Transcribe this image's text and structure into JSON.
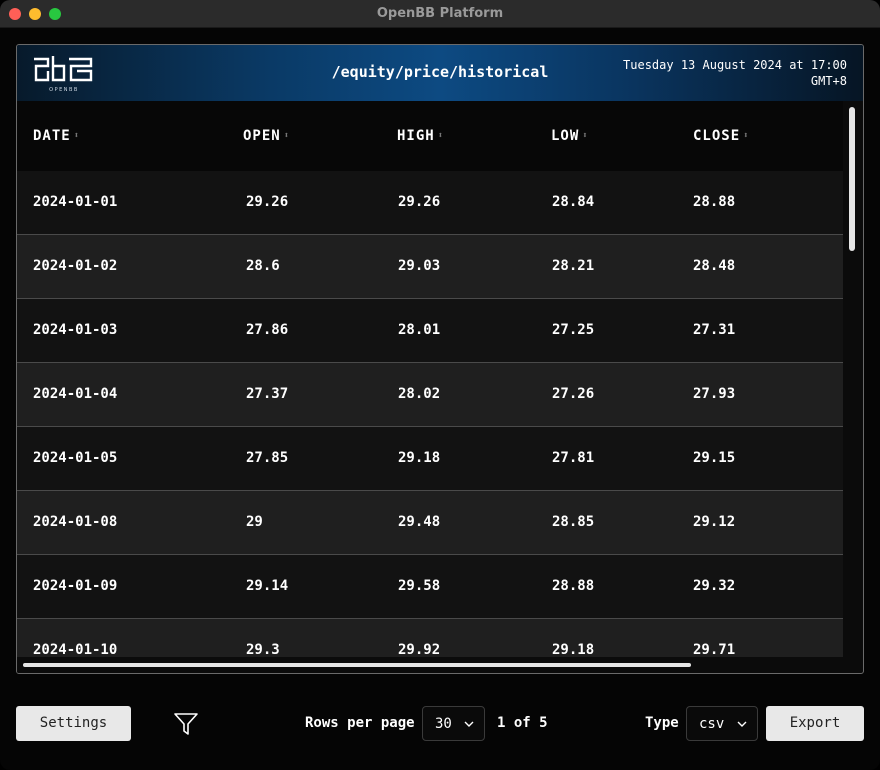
{
  "window": {
    "title": "OpenBB Platform"
  },
  "banner": {
    "logo_text": "OPENBB",
    "command": "/equity/price/historical",
    "date": "Tuesday 13 August 2024 at 17:00",
    "timezone": "GMT+8"
  },
  "table": {
    "columns": [
      "DATE",
      "OPEN",
      "HIGH",
      "LOW",
      "CLOSE"
    ],
    "rows": [
      [
        "2024-01-01",
        "29.26",
        "29.26",
        "28.84",
        "28.88"
      ],
      [
        "2024-01-02",
        "28.6",
        "29.03",
        "28.21",
        "28.48"
      ],
      [
        "2024-01-03",
        "27.86",
        "28.01",
        "27.25",
        "27.31"
      ],
      [
        "2024-01-04",
        "27.37",
        "28.02",
        "27.26",
        "27.93"
      ],
      [
        "2024-01-05",
        "27.85",
        "29.18",
        "27.81",
        "29.15"
      ],
      [
        "2024-01-08",
        "29",
        "29.48",
        "28.85",
        "29.12"
      ],
      [
        "2024-01-09",
        "29.14",
        "29.58",
        "28.88",
        "29.32"
      ],
      [
        "2024-01-10",
        "29.3",
        "29.92",
        "29.18",
        "29.71"
      ]
    ]
  },
  "footer": {
    "settings_label": "Settings",
    "filter_icon": "filter-icon",
    "rows_per_page_label": "Rows per page",
    "rows_per_page_value": "30",
    "page_current": "1",
    "page_of": "of",
    "page_total": "5",
    "type_label": "Type",
    "type_value": "csv",
    "export_label": "Export"
  }
}
